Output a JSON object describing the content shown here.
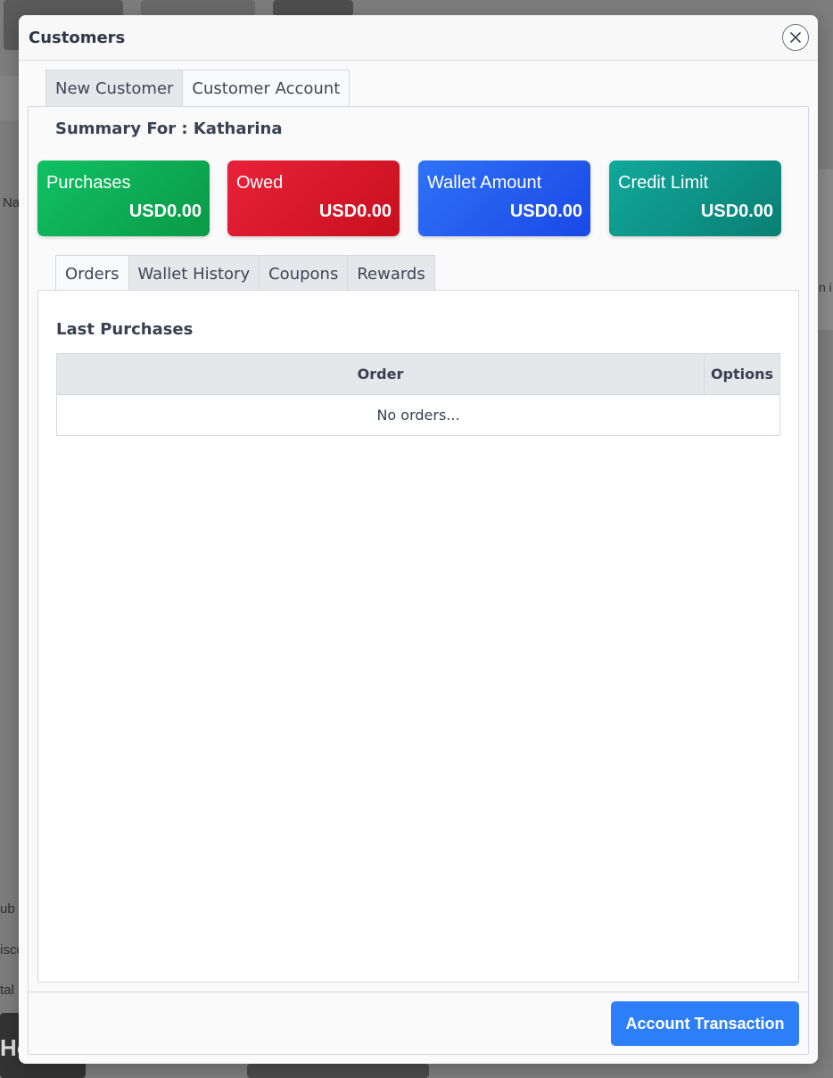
{
  "background": {
    "fragments": [
      "Na",
      "ub T",
      "isco",
      "tal",
      "Ho",
      "n i"
    ]
  },
  "modal": {
    "title": "Customers",
    "close_icon": "close-circle-icon",
    "tabs": [
      {
        "label": "New Customer",
        "active": false
      },
      {
        "label": "Customer Account",
        "active": true
      }
    ],
    "summary_title": "Summary For : Katharina",
    "cards": [
      {
        "label": "Purchases",
        "value": "USD0.00",
        "color": "#0fb85a"
      },
      {
        "label": "Owed",
        "value": "USD0.00",
        "color": "#dc1a2e"
      },
      {
        "label": "Wallet Amount",
        "value": "USD0.00",
        "color": "#2563f0"
      },
      {
        "label": "Credit Limit",
        "value": "USD0.00",
        "color": "#0d9488"
      }
    ],
    "inner_tabs": [
      {
        "label": "Orders",
        "active": true
      },
      {
        "label": "Wallet History",
        "active": false
      },
      {
        "label": "Coupons",
        "active": false
      },
      {
        "label": "Rewards",
        "active": false
      }
    ],
    "last_purchases": {
      "title": "Last Purchases",
      "columns": [
        "Order",
        "Options"
      ],
      "empty_text": "No orders..."
    },
    "footer": {
      "account_transaction_label": "Account Transaction"
    }
  }
}
